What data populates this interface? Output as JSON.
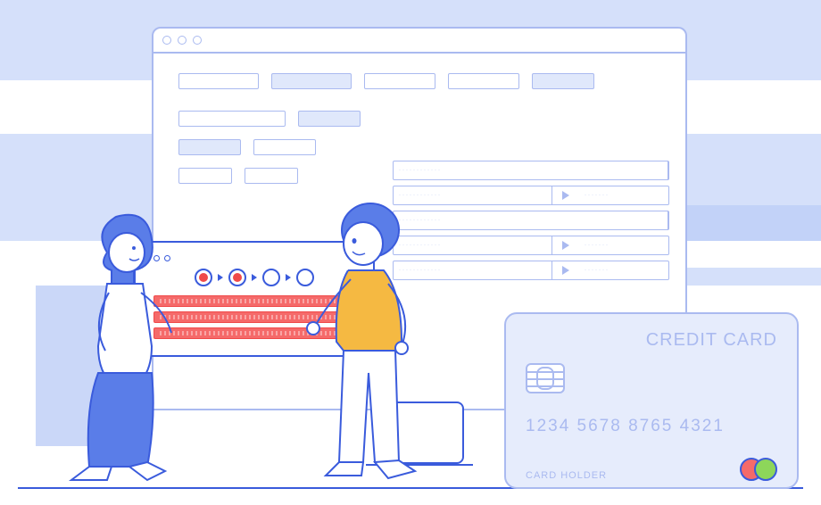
{
  "card": {
    "title": "CREDIT CARD",
    "number": "1234  5678  8765  4321",
    "holder_label": "CARD HOLDER"
  },
  "step_panel": {
    "total_steps": 4,
    "completed_steps": 2
  },
  "colors": {
    "outline_light": "#aabaf0",
    "outline_dark": "#3a5bdc",
    "bg_tint": "#b3c6f5",
    "accent_red": "#f56a6a",
    "accent_green": "#8dd65a",
    "accent_yellow": "#f5b942"
  }
}
